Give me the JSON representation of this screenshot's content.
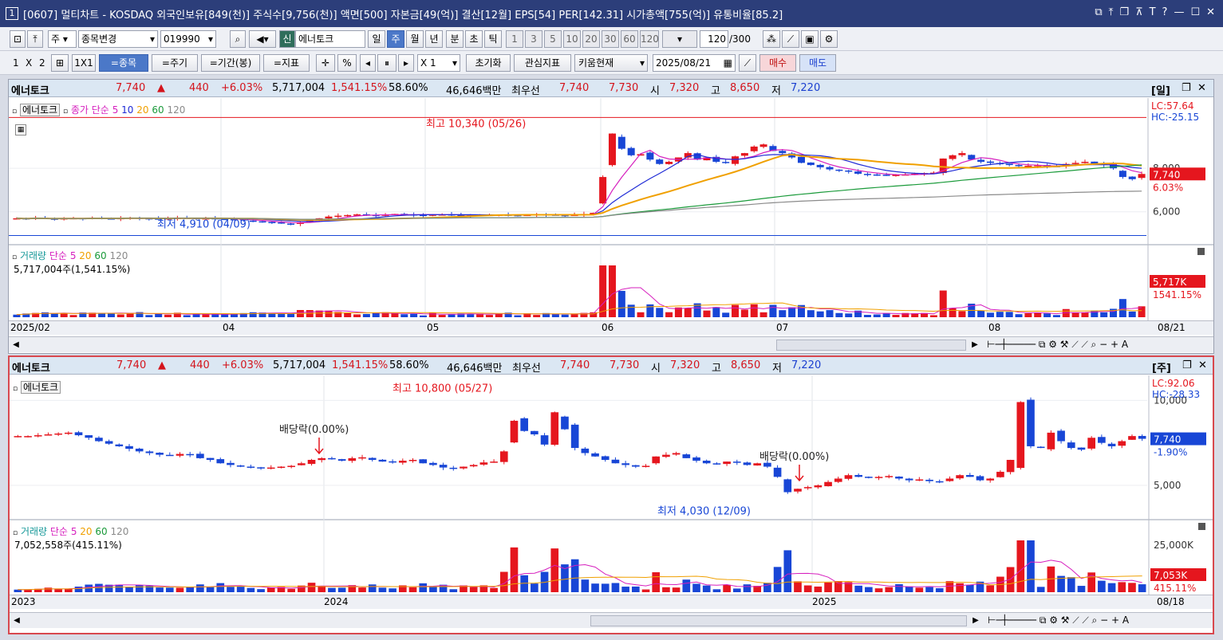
{
  "window": {
    "badge": "1",
    "title": "[0607] 멀티차트 - KOSDAQ 외국인보유[849(천)] 주식수[9,756(천)] 액면[500] 자본금[49(억)] 결산[12월] EPS[54] PER[142.31] 시가총액[755(억)] 유통비율[85.2]",
    "buttons": [
      "⧉",
      "⤒",
      "❐",
      "⊼",
      "T",
      "?",
      "—",
      "☐",
      "✕"
    ]
  },
  "toolbar1": {
    "market": "주",
    "change_label": "종목변경",
    "code": "019990",
    "new_badge": "신",
    "stock_name": "에너토크",
    "periods": [
      "일",
      "주",
      "월",
      "년",
      "분",
      "초",
      "틱"
    ],
    "selected_period": "주",
    "minutes": [
      "1",
      "3",
      "5",
      "10",
      "20",
      "30",
      "60",
      "120"
    ],
    "count": "120",
    "count_total": "/300"
  },
  "toolbar2": {
    "layout": [
      "1",
      "X",
      "2"
    ],
    "one_by_one": "1X1",
    "modes": [
      "=종목",
      "=주기",
      "=기간(봉)",
      "=지표"
    ],
    "percent": "%",
    "scale": "X 1",
    "reset": "초기화",
    "interest": "관심지표",
    "kiwoom": "키움현재",
    "date": "2025/08/21",
    "buy": "매수",
    "sell": "매도"
  },
  "quote": {
    "name": "에너토크",
    "price": "7,740",
    "arrow": "▲",
    "change": "440",
    "change_pct": "+6.03%",
    "volume": "5,717,004",
    "volume_pct": "1,541.15%",
    "turnover": "58.60%",
    "amount": "46,646백만",
    "best_label": "최우선",
    "ask": "7,740",
    "bid": "7,730",
    "open_label": "시",
    "open": "7,320",
    "high_label": "고",
    "high": "8,650",
    "low_label": "저",
    "low": "7,220"
  },
  "panel1": {
    "period_tag": "[일]",
    "legend_name": "에너토크",
    "legend_ma": "종가 단순",
    "ma_periods": [
      "5",
      "10",
      "20",
      "60",
      "120"
    ],
    "ma_colors": [
      "#d61fbe",
      "#1f2bd6",
      "#f0a000",
      "#1a9a3a",
      "#8a8a8a"
    ],
    "hi_note": "최고 10,340 (05/26)",
    "lo_note": "최저 4,910 (04/09)",
    "lc": "LC:57.64",
    "hc": "HC:-25.15",
    "price_tag": "7,740",
    "pct_tag": "6.03%",
    "yticks": [
      "6,000",
      "8,000"
    ],
    "vol_legend": "거래량",
    "vol_ma": "단순",
    "vol_info": "5,717,004주(1,541.15%)",
    "vol_tag": "5,717K",
    "vol_pct_tag": "1541.15%",
    "xlabels": [
      "2025/02",
      "04",
      "05",
      "06",
      "07",
      "08"
    ],
    "end_date": "08/21"
  },
  "panel2": {
    "period_tag": "[주]",
    "legend_name": "에너토크",
    "hi_note": "최고 10,800 (05/27)",
    "lo_note": "최저 4,030 (12/09)",
    "div_note1": "배당락(0.00%)",
    "div_note2": "배당락(0.00%)",
    "lc": "LC:92.06",
    "hc": "HC:-28.33",
    "price_tag": "7,740",
    "pct_tag": "-1.90%",
    "yticks": [
      "5,000",
      "10,000"
    ],
    "vol_legend": "거래량",
    "vol_ma": "단순",
    "vol_info": "7,052,558주(415.11%)",
    "vol_tag": "7,053K",
    "vol_pct_tag": "415.11%",
    "vol_ytick": "25,000K",
    "xlabels": [
      "2023",
      "2024",
      "2025"
    ],
    "end_date": "08/18"
  },
  "chart_data": [
    {
      "type": "candlestick",
      "period": "daily",
      "x_range": [
        "2025/02",
        "2025/08/21"
      ],
      "ylim": [
        5000,
        10500
      ],
      "high_marker": {
        "value": 10340,
        "date": "05/26"
      },
      "low_marker": {
        "value": 4910,
        "date": "04/09"
      },
      "last_close": 7740,
      "last_change_pct": 6.03,
      "closes": [
        5700,
        5680,
        5720,
        5690,
        5660,
        5700,
        5710,
        5690,
        5720,
        5700,
        5680,
        5710,
        5730,
        5700,
        5690,
        5680,
        5700,
        5720,
        5710,
        5690,
        5700,
        5680,
        5660,
        5650,
        5600,
        5560,
        5540,
        5500,
        5460,
        5450,
        5520,
        5600,
        5700,
        5780,
        5820,
        5850,
        5880,
        5860,
        5840,
        5870,
        5900,
        5880,
        5860,
        5850,
        5870,
        5880,
        5860,
        5840,
        5830,
        5850,
        5860,
        5870,
        5850,
        5840,
        5860,
        5880,
        5870,
        5850,
        5840,
        5860,
        5900,
        5950,
        7600,
        9600,
        8900,
        8600,
        8650,
        8400,
        8200,
        8300,
        8500,
        8700,
        8400,
        8500,
        8300,
        8250,
        8550,
        8700,
        9000,
        9100,
        8800,
        8700,
        8500,
        8250,
        8150,
        8050,
        7950,
        7900,
        7850,
        7750,
        7720,
        7700,
        7680,
        7700,
        7720,
        7750,
        7780,
        7800,
        8450,
        8600,
        8700,
        8400,
        8300,
        8250,
        8200,
        8150,
        8100,
        8120,
        8150,
        8100,
        8080,
        8200,
        8250,
        8300,
        8200,
        8150,
        8000,
        7600,
        7500,
        7740
      ],
      "volume_unit": "shares",
      "volume_last": 5717004,
      "ma_periods": [
        5,
        10,
        20,
        60,
        120
      ]
    },
    {
      "type": "candlestick",
      "period": "weekly",
      "x_range": [
        "2023",
        "2025/08/18"
      ],
      "ylim": [
        3500,
        11000
      ],
      "high_marker": {
        "value": 10800,
        "date": "05/27"
      },
      "low_marker": {
        "value": 4030,
        "date": "12/09"
      },
      "last_close": 7740,
      "last_change_pct": -1.9,
      "closes": [
        7900,
        7900,
        7950,
        8000,
        8050,
        8100,
        7950,
        7800,
        7600,
        7450,
        7300,
        7150,
        7000,
        6900,
        6800,
        6750,
        6850,
        6800,
        6600,
        6500,
        6300,
        6200,
        6100,
        6050,
        6000,
        6050,
        6100,
        6150,
        6300,
        6500,
        6600,
        6550,
        6450,
        6600,
        6650,
        6500,
        6400,
        6350,
        6450,
        6500,
        6300,
        6200,
        6050,
        6000,
        6100,
        6200,
        6350,
        6400,
        7000,
        8800,
        8200,
        8000,
        7400,
        9300,
        8300,
        7200,
        6900,
        6700,
        6500,
        6300,
        6200,
        6100,
        6150,
        6700,
        6800,
        6900,
        6600,
        6450,
        6300,
        6250,
        6400,
        6350,
        6200,
        6300,
        6100,
        5500,
        4600,
        4800,
        4900,
        5000,
        5200,
        5400,
        5600,
        5500,
        5450,
        5500,
        5550,
        5400,
        5300,
        5350,
        5250,
        5200,
        5400,
        5600,
        5500,
        5300,
        5400,
        5800,
        6500,
        9900,
        7300,
        7200,
        8100,
        7600,
        7200,
        7100,
        7800,
        7500,
        7300,
        7600,
        7900,
        7740
      ],
      "volume_last": 7052558,
      "volume_last_pct": 415.11
    }
  ]
}
